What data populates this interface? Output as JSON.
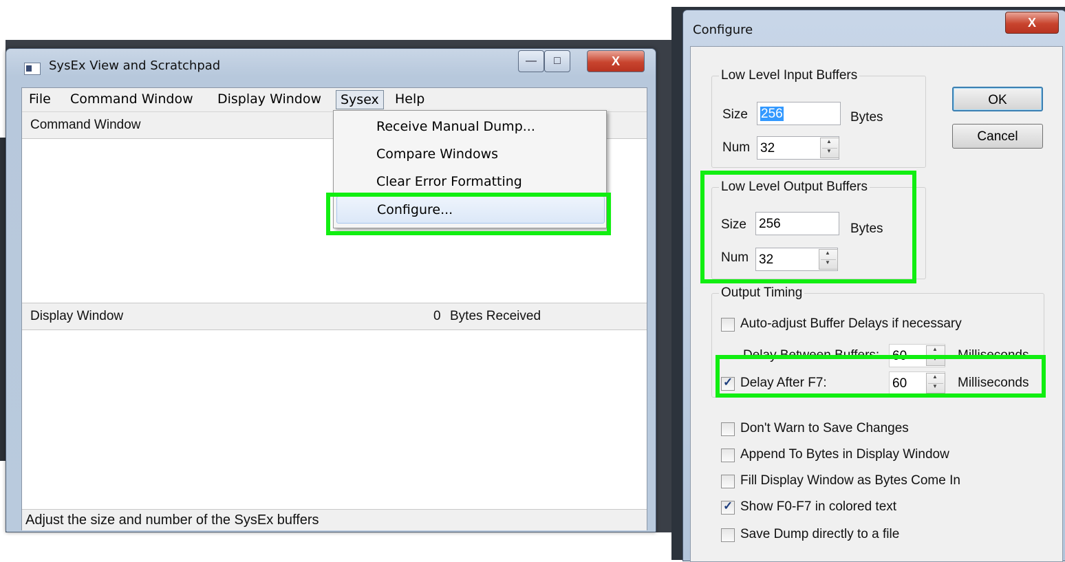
{
  "main_window": {
    "title": "SysEx View and Scratchpad",
    "caption_min": "—",
    "caption_max": "□",
    "caption_close": "X",
    "menu": [
      "File",
      "Command Window",
      "Display Window",
      "Sysex",
      "Help"
    ],
    "command_pane_label": "Command Window",
    "display_pane_label": "Display Window",
    "bytes_received_count": "0",
    "bytes_received_label": "Bytes Received",
    "status_text": "Adjust the size and number of the SysEx buffers"
  },
  "sysex_menu": {
    "items": [
      "Receive Manual Dump...",
      "Compare Windows",
      "Clear Error Formatting",
      "Configure..."
    ],
    "highlighted": "Configure..."
  },
  "configure_dialog": {
    "title": "Configure",
    "close": "X",
    "ok_label": "OK",
    "cancel_label": "Cancel",
    "input_buffers": {
      "group_label": "Low Level Input Buffers",
      "size_label": "Size",
      "size_value": "256",
      "size_unit": "Bytes",
      "num_label": "Num",
      "num_value": "32"
    },
    "output_buffers": {
      "group_label": "Low Level Output Buffers",
      "size_label": "Size",
      "size_value": "256",
      "size_unit": "Bytes",
      "num_label": "Num",
      "num_value": "32"
    },
    "output_timing": {
      "group_label": "Output Timing",
      "auto_adjust_label": "Auto-adjust Buffer Delays if necessary",
      "auto_adjust_checked": false,
      "delay_between_label": "Delay Between Buffers:",
      "delay_between_value": "60",
      "delay_between_unit": "Milliseconds",
      "delay_after_label": "Delay After F7:",
      "delay_after_checked": true,
      "delay_after_value": "60",
      "delay_after_unit": "Milliseconds"
    },
    "options": [
      {
        "label": "Don't Warn to Save Changes",
        "checked": false
      },
      {
        "label": "Append To Bytes in Display Window",
        "checked": false
      },
      {
        "label": "Fill Display Window as Bytes Come In",
        "checked": false
      },
      {
        "label": "Show F0-F7 in colored text",
        "checked": true
      },
      {
        "label": "Save Dump directly to a file",
        "checked": false
      }
    ]
  },
  "highlight_color": "#11ee11"
}
